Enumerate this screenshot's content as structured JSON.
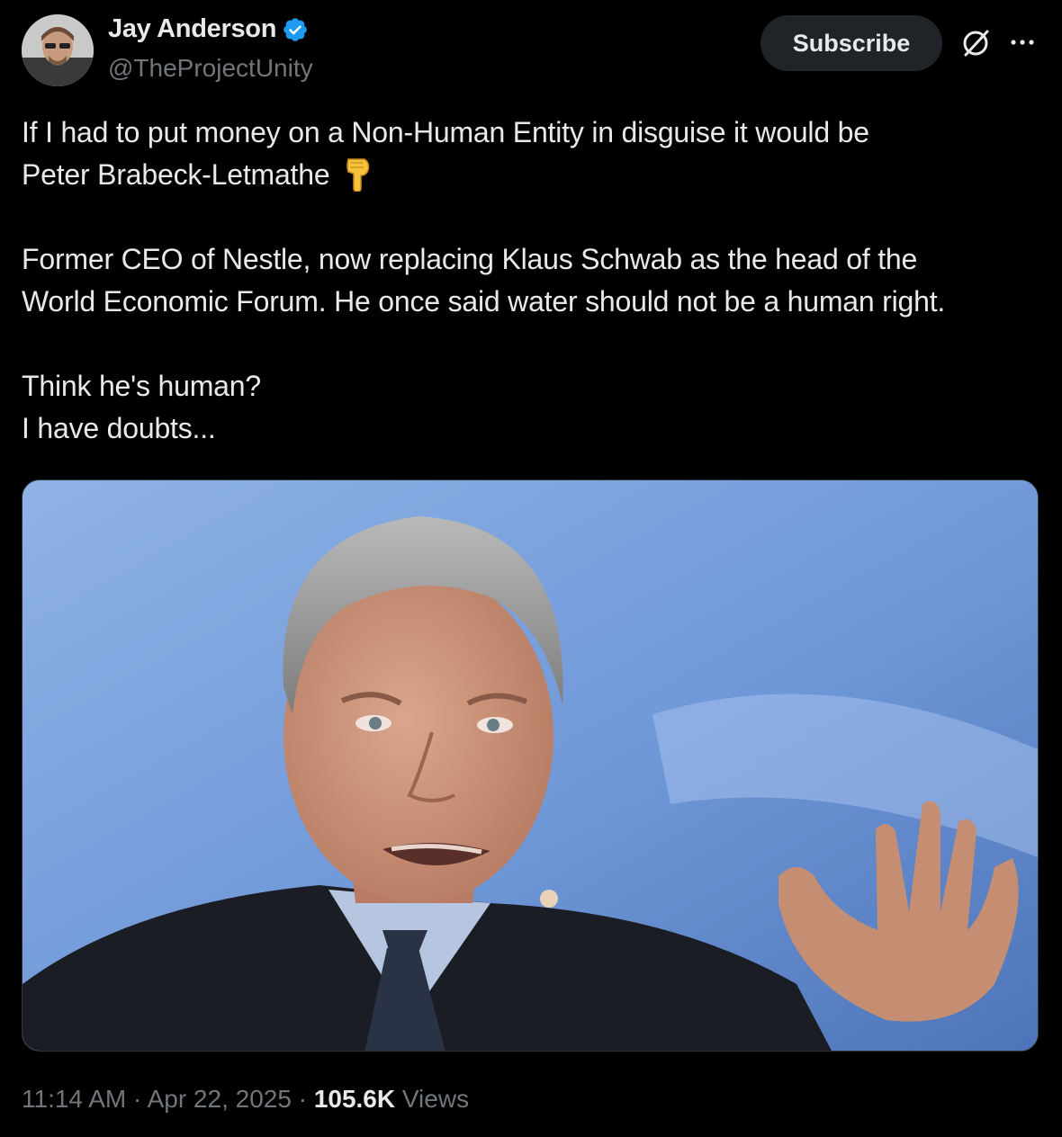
{
  "author": {
    "name": "Jay Anderson",
    "handle": "@TheProjectUnity",
    "verified": true
  },
  "header": {
    "subscribe_label": "Subscribe",
    "grok_icon": "grok-slash-circle-icon",
    "more_icon": "more-dots-icon"
  },
  "tweet": {
    "line1": "If I had to put money on a Non-Human Entity in disguise it would be",
    "line2": "Peter Brabeck-Letmathe",
    "line2_emoji": "backhand-index-pointing-down-emoji",
    "line3": "Former CEO of Nestle, now replacing Klaus Schwab as the head of the",
    "line4": "World Economic Forum. He once said water should not be a human right.",
    "line5": "Think he's human?",
    "line6": "I have doubts..."
  },
  "media": {
    "type": "photo",
    "description_icon": "portrait-photo"
  },
  "meta": {
    "time": "11:14 AM",
    "separator": "·",
    "date": "Apr 22, 2025",
    "views_count": "105.6K",
    "views_label": "Views"
  },
  "colors": {
    "background": "#000000",
    "text": "#e7e9ea",
    "secondary": "#71767b",
    "verified": "#1d9bf0",
    "button_bg": "#202327"
  }
}
